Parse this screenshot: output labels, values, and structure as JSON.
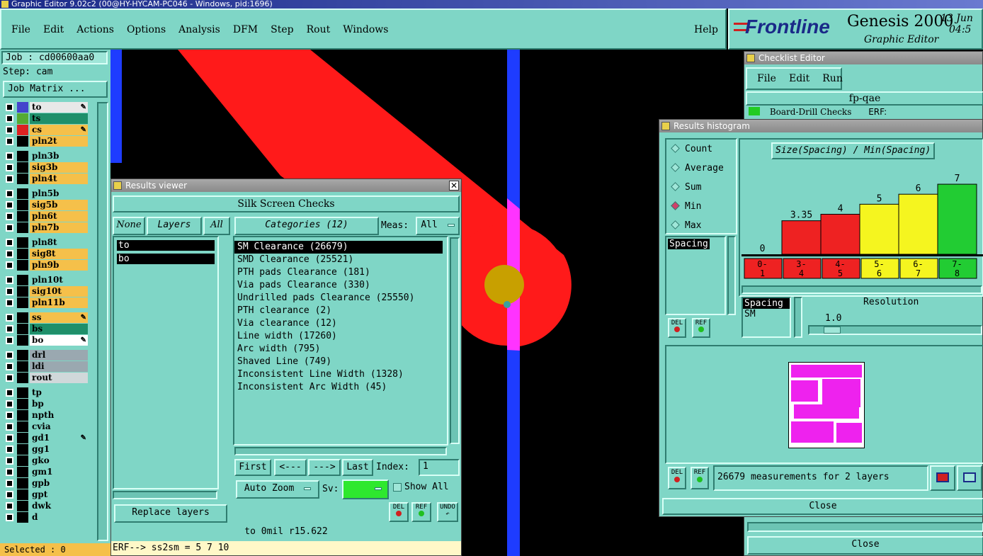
{
  "window_title": "Graphic Editor 9.02c2 (00@HY-HYCAM-PC046 - Windows, pid:1696)",
  "menu": [
    "File",
    "Edit",
    "Actions",
    "Options",
    "Analysis",
    "DFM",
    "Step",
    "Rout",
    "Windows"
  ],
  "help": "Help",
  "brand": {
    "logo": "Frontline",
    "product": "Genesis 2000",
    "subtitle": "Graphic Editor",
    "date": "13 Jun",
    "time": "04:5"
  },
  "job": {
    "job_label": "Job : cd00600aa0",
    "step_label": "Step: cam",
    "matrix_button": "Job Matrix ..."
  },
  "layers": [
    {
      "name": "to",
      "color": "#e8e8e8",
      "swatch": "#4444cc",
      "edit": "#ffffff",
      "mark": true
    },
    {
      "name": "ts",
      "color": "#1f8f6a",
      "swatch": "#55aa33",
      "edit": "#1f8f6a",
      "mark": false
    },
    {
      "name": "cs",
      "color": "#f5c04a",
      "swatch": "#dd2222",
      "edit": "#f5c04a",
      "mark": true
    },
    {
      "name": "pln2t",
      "color": "#f5c04a",
      "swatch": "#000000",
      "edit": "#f5c04a",
      "mark": false
    },
    {
      "name": "pln3b",
      "color": "#7fd6c6",
      "swatch": "#000000",
      "edit": "#7fd6c6",
      "mark": false
    },
    {
      "name": "sig3b",
      "color": "#f5c04a",
      "swatch": "#000000",
      "edit": "#f5c04a",
      "mark": false
    },
    {
      "name": "pln4t",
      "color": "#f5c04a",
      "swatch": "#000000",
      "edit": "#f5c04a",
      "mark": false
    },
    {
      "name": "pln5b",
      "color": "#7fd6c6",
      "swatch": "#000000",
      "edit": "#7fd6c6",
      "mark": false
    },
    {
      "name": "sig5b",
      "color": "#f5c04a",
      "swatch": "#000000",
      "edit": "#f5c04a",
      "mark": false
    },
    {
      "name": "pln6t",
      "color": "#f5c04a",
      "swatch": "#000000",
      "edit": "#f5c04a",
      "mark": false
    },
    {
      "name": "pln7b",
      "color": "#f5c04a",
      "swatch": "#000000",
      "edit": "#f5c04a",
      "mark": false
    },
    {
      "name": "pln8t",
      "color": "#7fd6c6",
      "swatch": "#000000",
      "edit": "#7fd6c6",
      "mark": false
    },
    {
      "name": "sig8t",
      "color": "#f5c04a",
      "swatch": "#000000",
      "edit": "#f5c04a",
      "mark": false
    },
    {
      "name": "pln9b",
      "color": "#f5c04a",
      "swatch": "#000000",
      "edit": "#f5c04a",
      "mark": false
    },
    {
      "name": "pln10t",
      "color": "#7fd6c6",
      "swatch": "#000000",
      "edit": "#7fd6c6",
      "mark": false
    },
    {
      "name": "sig10t",
      "color": "#f5c04a",
      "swatch": "#000000",
      "edit": "#f5c04a",
      "mark": false
    },
    {
      "name": "pln11b",
      "color": "#f5c04a",
      "swatch": "#000000",
      "edit": "#f5c04a",
      "mark": false
    },
    {
      "name": "ss",
      "color": "#f5c04a",
      "swatch": "#000000",
      "edit": "#f5c04a",
      "mark": true
    },
    {
      "name": "bs",
      "color": "#1f8f6a",
      "swatch": "#000000",
      "edit": "#1f8f6a",
      "mark": false
    },
    {
      "name": "bo",
      "color": "#ffffff",
      "swatch": "#000000",
      "edit": "#ffffff",
      "mark": true
    },
    {
      "name": "drl",
      "color": "#9aa8b0",
      "swatch": "#000000",
      "edit": "#9aa8b0",
      "mark": false
    },
    {
      "name": "ldi",
      "color": "#9aa8b0",
      "swatch": "#000000",
      "edit": "#9aa8b0",
      "mark": false
    },
    {
      "name": "rout",
      "color": "#d0d8da",
      "swatch": "#000000",
      "edit": "#d0d8da",
      "mark": false
    },
    {
      "name": "tp",
      "color": "#7fd6c6",
      "swatch": "#000000",
      "edit": "#7fd6c6",
      "mark": false
    },
    {
      "name": "bp",
      "color": "#7fd6c6",
      "swatch": "#000000",
      "edit": "#7fd6c6",
      "mark": false
    },
    {
      "name": "npth",
      "color": "#7fd6c6",
      "swatch": "#000000",
      "edit": "#7fd6c6",
      "mark": false
    },
    {
      "name": "cvia",
      "color": "#7fd6c6",
      "swatch": "#000000",
      "edit": "#7fd6c6",
      "mark": false
    },
    {
      "name": "gd1",
      "color": "#7fd6c6",
      "swatch": "#000000",
      "edit": "#7fd6c6",
      "mark": true
    },
    {
      "name": "gg1",
      "color": "#7fd6c6",
      "swatch": "#000000",
      "edit": "#7fd6c6",
      "mark": false
    },
    {
      "name": "gko",
      "color": "#7fd6c6",
      "swatch": "#000000",
      "edit": "#7fd6c6",
      "mark": false
    },
    {
      "name": "gm1",
      "color": "#7fd6c6",
      "swatch": "#000000",
      "edit": "#7fd6c6",
      "mark": false
    },
    {
      "name": "gpb",
      "color": "#7fd6c6",
      "swatch": "#000000",
      "edit": "#7fd6c6",
      "mark": false
    },
    {
      "name": "gpt",
      "color": "#7fd6c6",
      "swatch": "#000000",
      "edit": "#7fd6c6",
      "mark": false
    },
    {
      "name": "dwk",
      "color": "#7fd6c6",
      "swatch": "#000000",
      "edit": "#7fd6c6",
      "mark": false
    },
    {
      "name": "d",
      "color": "#7fd6c6",
      "swatch": "#000000",
      "edit": "#7fd6c6",
      "mark": false
    }
  ],
  "selected": "Selected : 0",
  "results_viewer": {
    "title": "Results viewer",
    "header": "Silk Screen Checks",
    "none": "None",
    "layers_btn": "Layers",
    "all": "All",
    "layer_items": [
      "to",
      "bo"
    ],
    "categories_btn": "Categories (12)",
    "meas_label": "Meas:",
    "meas_value": "All",
    "categories": [
      "SM Clearance (26679)",
      "SMD Clearance (25521)",
      "PTH pads Clearance (181)",
      "Via pads Clearance (330)",
      "Undrilled pads Clearance (25550)",
      "PTH clearance (2)",
      "Via clearance (12)",
      "Line width (17260)",
      "Arc width (795)",
      "Shaved Line (749)",
      "Inconsistent Line Width (1328)",
      "Inconsistent Arc Width (45)"
    ],
    "first": "First",
    "prev": "<---",
    "next": "--->",
    "last": "Last",
    "index_label": "Index:",
    "index_value": "1",
    "auto_zoom": "Auto Zoom",
    "sv_label": "Sv:",
    "show_all": "Show All",
    "replace_layers": "Replace layers",
    "del": "DEL",
    "ref": "REF",
    "undo": "UNDO",
    "status": "to  0mil  r15.622",
    "erf": "ERF--> ss2sm = 5 7 10"
  },
  "checklist": {
    "title": "Checklist Editor",
    "menu": [
      "File",
      "Edit",
      "Run"
    ],
    "name": "fp-qae",
    "row_text": "Board-Drill Checks",
    "erf": "ERF:",
    "close": "Close"
  },
  "histogram": {
    "title": "Results histogram",
    "options": [
      "Count",
      "Average",
      "Sum",
      "Min",
      "Max"
    ],
    "selected_option": "Min",
    "list_item": "Spacing",
    "chart_title": "Size(Spacing) / Min(Spacing)",
    "del": "DEL",
    "ref": "REF",
    "lower_list": [
      "Spacing",
      "SM"
    ],
    "resolution_label": "Resolution",
    "resolution_value": "1.0",
    "summary": "26679 measurements for 2 layers",
    "close": "Close"
  },
  "chart_data": {
    "type": "bar",
    "title": "Size(Spacing) / Min(Spacing)",
    "categories": [
      "0-1",
      "3-4",
      "4-5",
      "5-6",
      "6-7",
      "7-8"
    ],
    "values": [
      0,
      3.35,
      4,
      5,
      6,
      7
    ],
    "value_labels": [
      "0",
      "3.35",
      "4",
      "5",
      "6",
      "7"
    ],
    "bar_colors": [
      "#ee2222",
      "#ee2222",
      "#ee2222",
      "#f5f51f",
      "#f5f51f",
      "#22cc33"
    ],
    "ylim": [
      0,
      7.5
    ]
  }
}
